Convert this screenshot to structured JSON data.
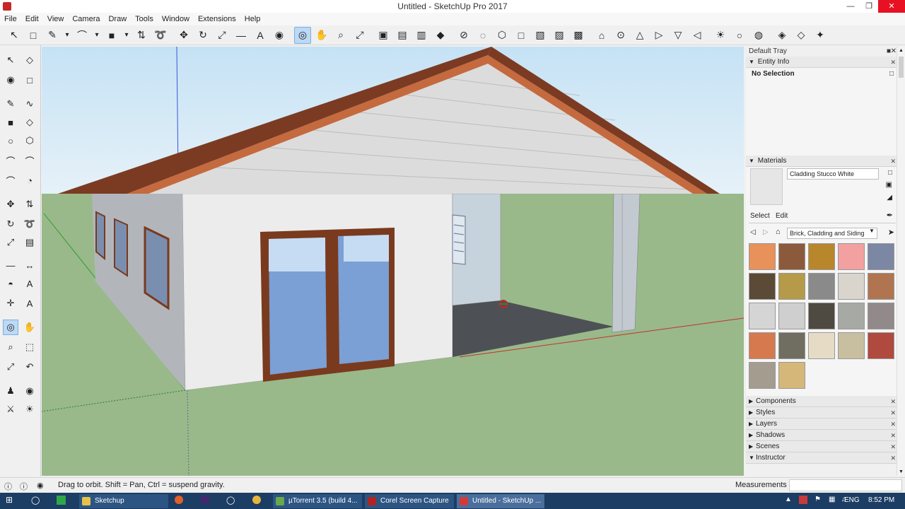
{
  "window": {
    "title": "Untitled - SketchUp Pro 2017"
  },
  "menu": [
    "File",
    "Edit",
    "View",
    "Camera",
    "Draw",
    "Tools",
    "Window",
    "Extensions",
    "Help"
  ],
  "toolbar_icons": [
    "select-icon",
    "eraser-icon",
    "pencil-icon",
    "dropdown-icon",
    "arc-icon",
    "dropdown-icon",
    "rectangle-icon",
    "dropdown-icon",
    "push-pull-icon",
    "follow-me-icon",
    "move-icon",
    "rotate-icon",
    "scale-icon",
    "tape-measure-icon",
    "text-icon",
    "paint-bucket-icon",
    "orbit-icon",
    "pan-icon",
    "zoom-icon",
    "zoom-extents-icon",
    "warehouse-icon",
    "extension-warehouse-icon",
    "send-to-layout-icon",
    "ruby-icon",
    "x-ray-icon",
    "back-edges-icon",
    "wireframe-icon",
    "hidden-line-icon",
    "shaded-icon",
    "shaded-textures-icon",
    "monochrome-icon",
    "iso-view-icon",
    "top-view-icon",
    "front-view-icon",
    "right-view-icon",
    "back-view-icon",
    "left-view-icon",
    "section-plane-icon",
    "section-display-icon",
    "section-cut-icon",
    "sandbox-icon",
    "sandbox-scratch-icon",
    "sandbox-smoove-icon"
  ],
  "tray": {
    "title": "Default Tray",
    "entity_info": {
      "header": "Entity Info",
      "selection": "No Selection"
    },
    "materials": {
      "header": "Materials",
      "current_material": "Cladding Stucco White",
      "tab_select": "Select",
      "tab_edit": "Edit",
      "library": "Brick, Cladding and Siding",
      "swatches": [
        "#e8915a",
        "#8b5a3c",
        "#b8862b",
        "#f2a0a0",
        "#7c87a3",
        "#5b4a36",
        "#b59a4a",
        "#8a8a8a",
        "#d9d4cc",
        "#b07550",
        "#d5d5d5",
        "#cfcfcf",
        "#4e4a42",
        "#a7a9a4",
        "#92898b",
        "#d7794f",
        "#6f6e60",
        "#e6dcc6",
        "#c7bfa0",
        "#b04a3e",
        "#a59c90",
        "#d6b77a"
      ]
    },
    "collapsed": [
      "Components",
      "Styles",
      "Layers",
      "Shadows",
      "Scenes",
      "Instructor"
    ]
  },
  "status": {
    "hint": "Drag to orbit. Shift = Pan, Ctrl = suspend gravity.",
    "measurements_label": "Measurements",
    "measurements_value": ""
  },
  "taskbar": {
    "items": [
      "Sketchup",
      "µTorrent 3.5  (build 4...",
      "Corel Screen Capture",
      "Untitled - SketchUp ..."
    ],
    "lang": "ENG",
    "time": "8:52 PM"
  }
}
